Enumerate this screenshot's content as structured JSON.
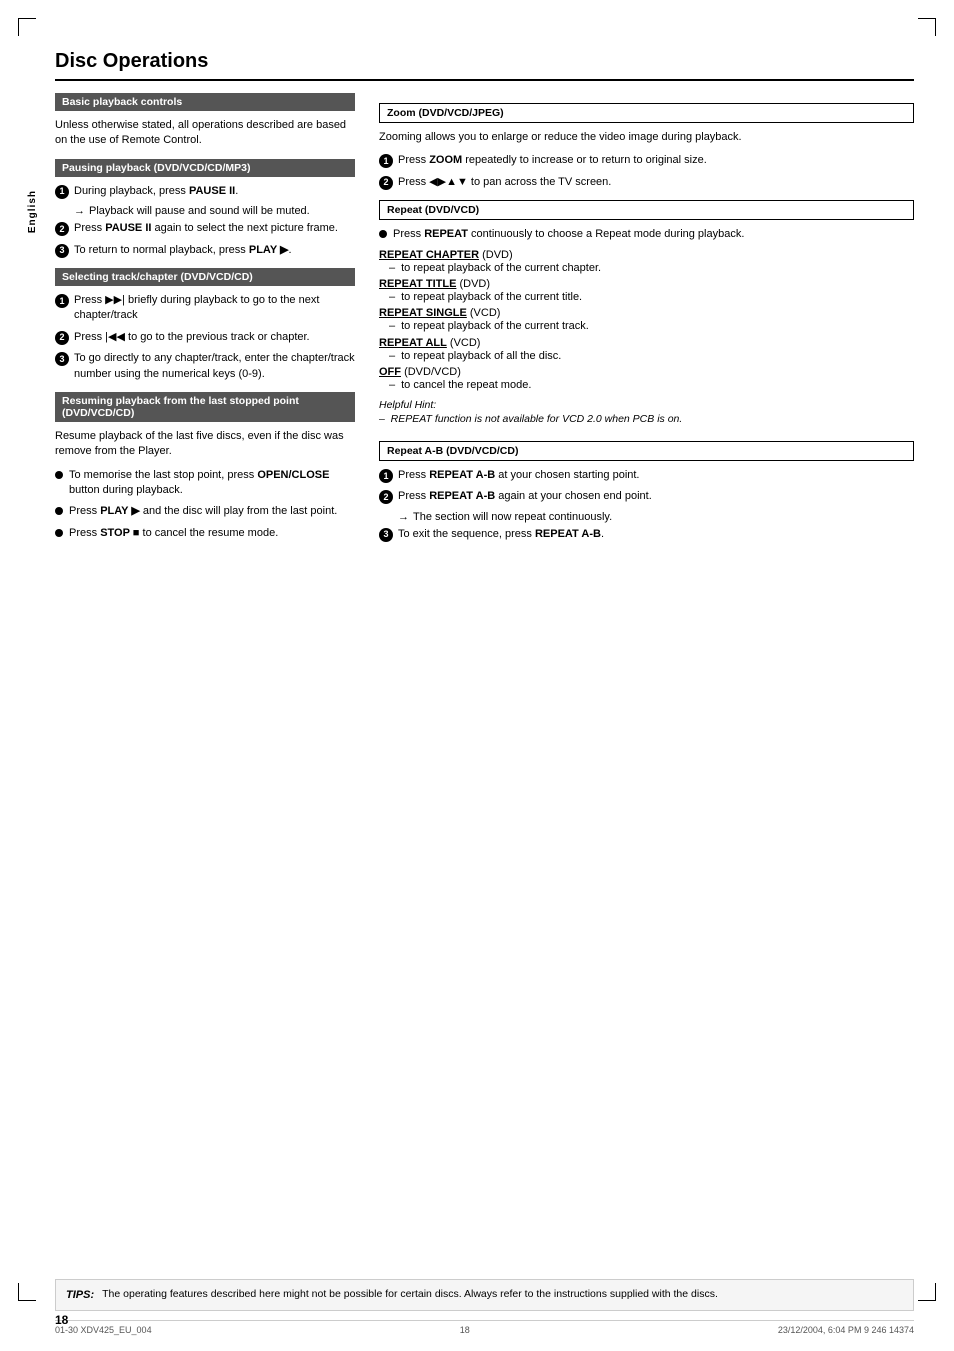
{
  "page": {
    "title": "Disc Operations",
    "page_number": "18",
    "sidebar_label": "English",
    "footer_left": "01-30 XDV425_EU_004",
    "footer_mid": "18",
    "footer_right": "23/12/2004, 6:04 PM  9 246 14374"
  },
  "tips": {
    "label": "TIPS:",
    "text": "The operating features described here might not be possible for certain discs.  Always refer to the instructions supplied with the discs."
  },
  "left_col": {
    "basic_section": {
      "header": "Basic playback controls",
      "intro": "Unless otherwise stated, all operations described are based on the use of Remote Control."
    },
    "pausing_section": {
      "header": "Pausing playback (DVD/VCD/CD/MP3)",
      "items": [
        {
          "num": "1",
          "text": "During playback, press ",
          "bold": "PAUSE II",
          "text2": ".",
          "arrow": "→ Playback will pause and sound will be muted."
        },
        {
          "num": "2",
          "text": "Press ",
          "bold": "PAUSE II",
          "text2": " again to select the next picture frame."
        },
        {
          "num": "3",
          "text": "To return to normal playback, press ",
          "bold": "PLAY ▶",
          "text2": "."
        }
      ]
    },
    "selecting_section": {
      "header": "Selecting track/chapter (DVD/VCD/CD)",
      "items": [
        {
          "num": "1",
          "text": "Press ▶▶| briefly during playback to go to the next chapter/track"
        },
        {
          "num": "2",
          "text": "Press |◀◀ to go to the previous track or chapter."
        },
        {
          "num": "3",
          "text": "To go directly to any chapter/track, enter the chapter/track number using the numerical keys (0-9)."
        }
      ]
    },
    "resuming_section": {
      "header": "Resuming playback from the last stopped point (DVD/VCD/CD)",
      "intro": "Resume playback of the last five discs, even if the disc was remove from the Player.",
      "bullets": [
        {
          "text_pre": "To memorise the last stop point, press ",
          "bold": "OPEN/CLOSE",
          "text_post": " button during playback."
        },
        {
          "text_pre": "Press ",
          "bold": "PLAY ▶",
          "text_post": " and the disc will play from the last point."
        },
        {
          "text_pre": "Press ",
          "bold": "STOP ■",
          "text_post": " to cancel the resume mode."
        }
      ]
    }
  },
  "right_col": {
    "zoom_section": {
      "header": "Zoom (DVD/VCD/JPEG)",
      "intro": "Zooming allows you to enlarge or reduce the video image during playback.",
      "items": [
        {
          "num": "1",
          "text_pre": "Press ",
          "bold": "ZOOM",
          "text_post": " repeatedly to increase or to return to original size."
        },
        {
          "num": "2",
          "text_pre": "Press ◀▶▲▼ to pan across the TV screen."
        }
      ]
    },
    "repeat_section": {
      "header": "Repeat (DVD/VCD)",
      "bullet_text_pre": "Press ",
      "bullet_bold": "REPEAT",
      "bullet_text_post": " continuously to choose a Repeat mode during playback.",
      "categories": [
        {
          "title": "REPEAT CHAPTER",
          "subtitle": "(DVD)",
          "dash": "to repeat playback of the current chapter."
        },
        {
          "title": "REPEAT TITLE",
          "subtitle": "(DVD)",
          "dash": "to repeat playback of the current title."
        },
        {
          "title": "REPEAT SINGLE",
          "subtitle": "(VCD)",
          "dash": "to repeat playback of the current track."
        },
        {
          "title": "REPEAT ALL",
          "subtitle": "(VCD)",
          "dash": "to repeat playback of all the disc."
        },
        {
          "title": "OFF",
          "subtitle": "(DVD/VCD)",
          "dash": "to cancel the repeat mode."
        }
      ],
      "helpful_hint": {
        "label": "Helpful Hint:",
        "text": "– REPEAT function is not available for VCD 2.0 when PCB is on."
      }
    },
    "repeat_ab_section": {
      "header": "Repeat A-B (DVD/VCD/CD)",
      "items": [
        {
          "num": "1",
          "text_pre": "Press ",
          "bold": "REPEAT A-B",
          "text_post": " at your chosen starting point."
        },
        {
          "num": "2",
          "text_pre": "Press ",
          "bold": "REPEAT A-B",
          "text_post": " again at your chosen end point.",
          "arrow": "→ The section will now repeat continuously."
        },
        {
          "num": "3",
          "text_pre": "To exit the sequence, press ",
          "bold": "REPEAT A-B",
          "text_post": "."
        }
      ]
    }
  }
}
